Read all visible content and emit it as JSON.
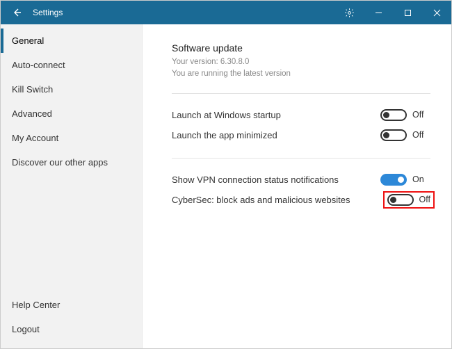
{
  "titlebar": {
    "title": "Settings"
  },
  "sidebar": {
    "items": [
      {
        "label": "General",
        "active": true
      },
      {
        "label": "Auto-connect"
      },
      {
        "label": "Kill Switch"
      },
      {
        "label": "Advanced"
      },
      {
        "label": "My Account"
      },
      {
        "label": "Discover our other apps"
      }
    ],
    "bottom": [
      {
        "label": "Help Center"
      },
      {
        "label": "Logout"
      }
    ]
  },
  "main": {
    "update": {
      "title": "Software update",
      "version": "Your version: 6.30.8.0",
      "status": "You are running the latest version"
    },
    "rows": [
      {
        "label": "Launch at Windows startup",
        "state": "Off",
        "on": false
      },
      {
        "label": "Launch the app minimized",
        "state": "Off",
        "on": false
      }
    ],
    "rows2": [
      {
        "label": "Show VPN connection status notifications",
        "state": "On",
        "on": true
      },
      {
        "label": "CyberSec: block ads and malicious websites",
        "state": "Off",
        "on": false,
        "highlight": true
      }
    ]
  }
}
